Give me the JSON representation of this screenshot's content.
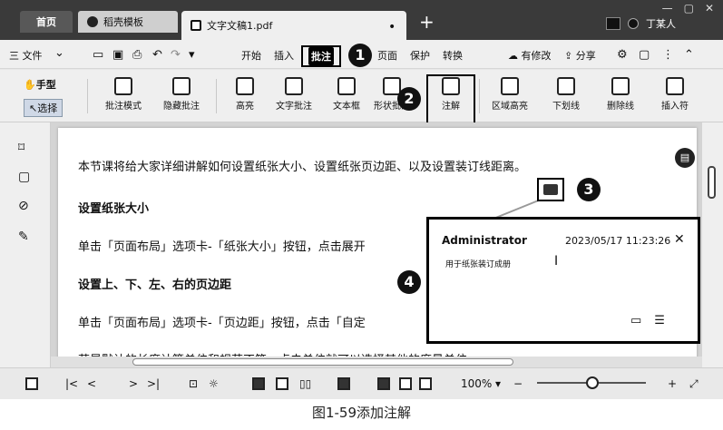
{
  "tabs": {
    "home": "首页",
    "templates": "稻壳模板",
    "document": "文字文稿1.pdf",
    "add": "+"
  },
  "window": {
    "min": "—",
    "max": "▢",
    "close": "✕"
  },
  "account": {
    "name": "丁某人"
  },
  "menu": {
    "file": "三 文件",
    "items": [
      "开始",
      "插入",
      "批注",
      "页面",
      "保护",
      "转换"
    ],
    "active": "批注",
    "right": {
      "changes": "有修改",
      "share": "分享"
    }
  },
  "ribbon": {
    "hand": "手型",
    "select": "选择",
    "buttons": [
      "批注模式",
      "隐藏批注",
      "高亮",
      "文字批注",
      "文本框",
      "形状批注",
      "注解",
      "区域高亮",
      "下划线",
      "删除线",
      "插入符"
    ]
  },
  "document": {
    "para1": "本节课将给大家详细讲解如何设置纸张大小、设置纸张页边距、以及设置装订线距离。",
    "heading1": "设置纸张大小",
    "para2": "单击「页面布局」选项卡-「纸张大小」按钮，点击展开",
    "heading2": "设置上、下、左、右的页边距",
    "para3": "单击「页面布局」选项卡-「页边距」按钮，点击「自定",
    "para4": "若是默认的长度计算单位和规范不符，点击单位就可以选择其他的度量单位。"
  },
  "comment": {
    "user": "Administrator",
    "time": "2023/05/17 11:23:26",
    "text": "用于纸张装订成册"
  },
  "markers": [
    "1",
    "2",
    "3",
    "4"
  ],
  "statusbar": {
    "zoom": "100%"
  },
  "caption": "图1-59添加注解"
}
